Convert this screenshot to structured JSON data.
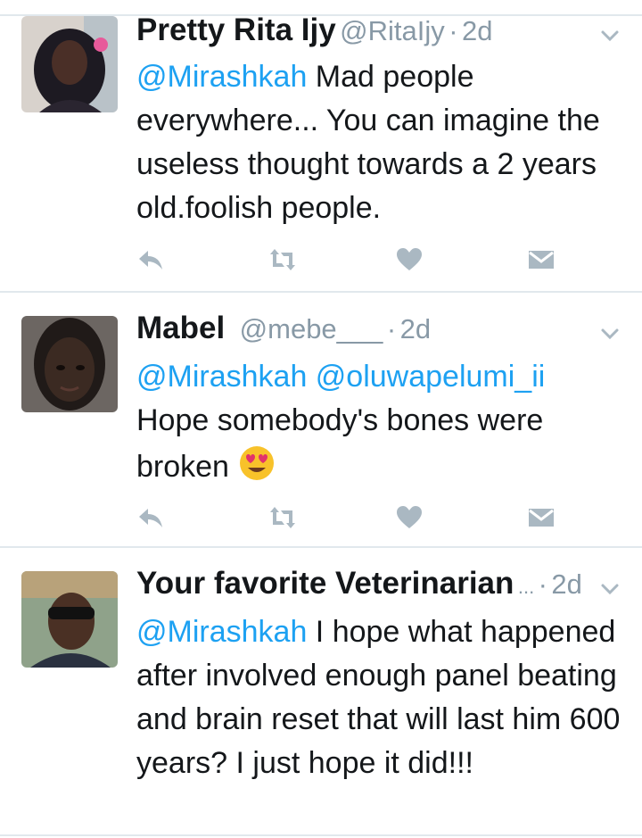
{
  "tweets": [
    {
      "name": "Pretty Rita Ijy",
      "handle": "@RitaIjy",
      "separator": "·",
      "time": "2d",
      "mentions": "@Mirashkah",
      "body": " Mad people everywhere... You can imagine the useless thought towards a 2 years old.foolish people."
    },
    {
      "name": "Mabel",
      "handle": "@mebe___",
      "separator": "·",
      "time": "2d",
      "mentions": "@Mirashkah @oluwapelumi_ii",
      "body": " Hope somebody's bones were broken ",
      "emoji": "heart-eyes-emoji"
    },
    {
      "name": "Your favorite Veterinarian",
      "handle": "...",
      "separator": "·",
      "time": "2d",
      "mentions": "@Mirashkah",
      "body": " I hope what happened after involved enough panel beating and brain reset that will last him 600 years? I just hope it did!!!"
    }
  ],
  "icons": [
    "reply-icon",
    "retweet-icon",
    "like-icon",
    "direct-message-icon",
    "chevron-down-icon"
  ],
  "colors": {
    "mention": "#1da1f2",
    "meta": "#8899a6",
    "icon": "#aab8c2",
    "divider": "#e1e8ed"
  }
}
